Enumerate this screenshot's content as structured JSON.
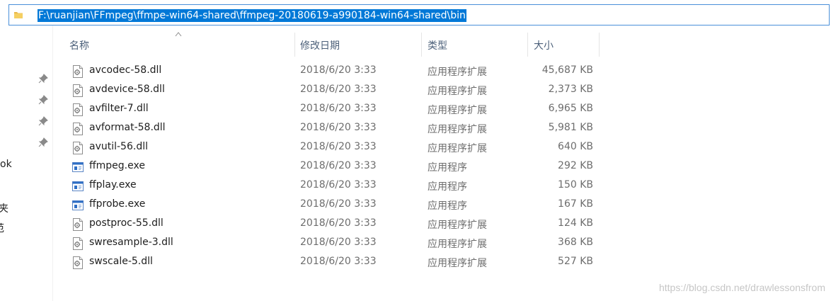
{
  "address_bar": {
    "path": "F:\\ruanjian\\FFmpeg\\ffmpe-win64-shared\\ffmpeg-20180619-a990184-win64-shared\\bin"
  },
  "nav_fragments": [
    "ok",
    "夹",
    "范"
  ],
  "columns": {
    "name": "名称",
    "date": "修改日期",
    "type": "类型",
    "size": "大小"
  },
  "files": [
    {
      "name": "avcodec-58.dll",
      "date": "2018/6/20 3:33",
      "type": "应用程序扩展",
      "size": "45,687 KB",
      "icon": "dll-file-icon"
    },
    {
      "name": "avdevice-58.dll",
      "date": "2018/6/20 3:33",
      "type": "应用程序扩展",
      "size": "2,373 KB",
      "icon": "dll-file-icon"
    },
    {
      "name": "avfilter-7.dll",
      "date": "2018/6/20 3:33",
      "type": "应用程序扩展",
      "size": "6,965 KB",
      "icon": "dll-file-icon"
    },
    {
      "name": "avformat-58.dll",
      "date": "2018/6/20 3:33",
      "type": "应用程序扩展",
      "size": "5,981 KB",
      "icon": "dll-file-icon"
    },
    {
      "name": "avutil-56.dll",
      "date": "2018/6/20 3:33",
      "type": "应用程序扩展",
      "size": "640 KB",
      "icon": "dll-file-icon"
    },
    {
      "name": "ffmpeg.exe",
      "date": "2018/6/20 3:33",
      "type": "应用程序",
      "size": "292 KB",
      "icon": "exe-file-icon"
    },
    {
      "name": "ffplay.exe",
      "date": "2018/6/20 3:33",
      "type": "应用程序",
      "size": "150 KB",
      "icon": "exe-file-icon"
    },
    {
      "name": "ffprobe.exe",
      "date": "2018/6/20 3:33",
      "type": "应用程序",
      "size": "167 KB",
      "icon": "exe-file-icon"
    },
    {
      "name": "postproc-55.dll",
      "date": "2018/6/20 3:33",
      "type": "应用程序扩展",
      "size": "124 KB",
      "icon": "dll-file-icon"
    },
    {
      "name": "swresample-3.dll",
      "date": "2018/6/20 3:33",
      "type": "应用程序扩展",
      "size": "368 KB",
      "icon": "dll-file-icon"
    },
    {
      "name": "swscale-5.dll",
      "date": "2018/6/20 3:33",
      "type": "应用程序扩展",
      "size": "527 KB",
      "icon": "dll-file-icon"
    }
  ],
  "watermark": "https://blog.csdn.net/drawlessonsfrom",
  "colors": {
    "selection": "#0078d7",
    "header_text": "#4c607a",
    "detail_text": "#6d6d6d"
  }
}
